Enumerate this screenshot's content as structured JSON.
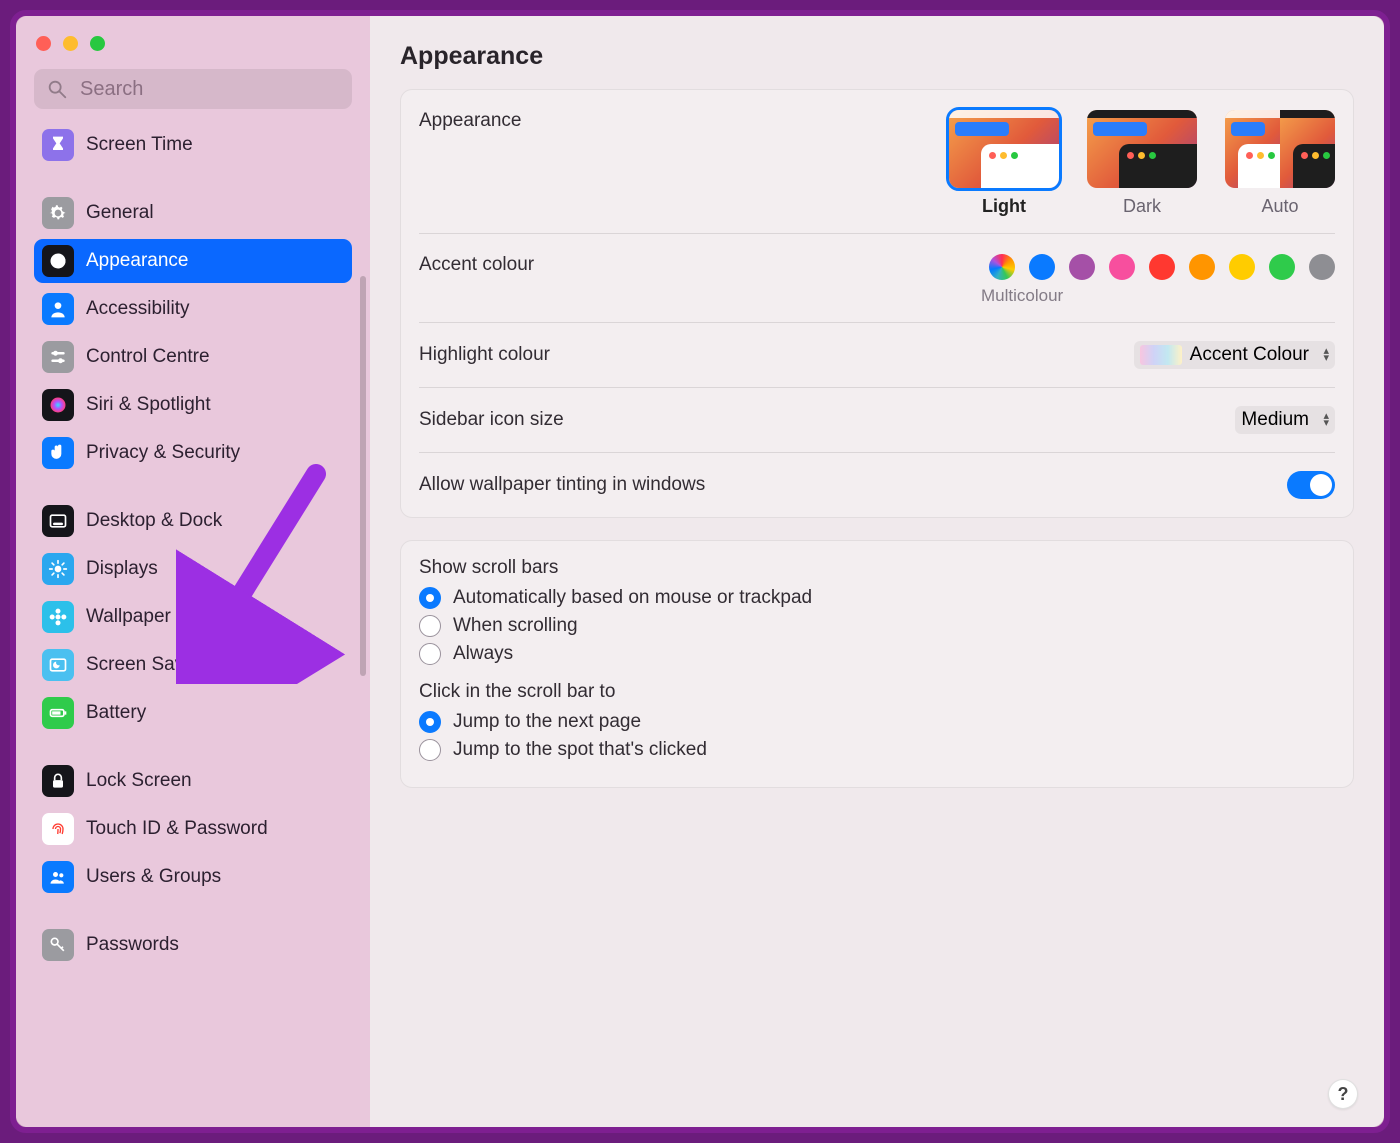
{
  "search": {
    "placeholder": "Search"
  },
  "page_title": "Appearance",
  "sidebar": {
    "items": [
      {
        "label": "Screen Time",
        "icon": "hourglass",
        "bg": "#8d72ea",
        "fg": "#ffffff"
      },
      {
        "gap": true
      },
      {
        "label": "General",
        "icon": "gear",
        "bg": "#9b9ba0",
        "fg": "#ffffff"
      },
      {
        "label": "Appearance",
        "icon": "contrast",
        "bg": "#15151a",
        "fg": "#ffffff",
        "selected": true
      },
      {
        "label": "Accessibility",
        "icon": "person",
        "bg": "#0a7aff",
        "fg": "#ffffff"
      },
      {
        "label": "Control Centre",
        "icon": "sliders",
        "bg": "#9b9ba0",
        "fg": "#ffffff"
      },
      {
        "label": "Siri & Spotlight",
        "icon": "siri",
        "bg": "#15151a",
        "fg": "#ffffff"
      },
      {
        "label": "Privacy & Security",
        "icon": "hand",
        "bg": "#0a7aff",
        "fg": "#ffffff"
      },
      {
        "gap": true
      },
      {
        "label": "Desktop & Dock",
        "icon": "dock",
        "bg": "#15151a",
        "fg": "#ffffff"
      },
      {
        "label": "Displays",
        "icon": "sun",
        "bg": "#2aa7ef",
        "fg": "#ffffff"
      },
      {
        "label": "Wallpaper",
        "icon": "flower",
        "bg": "#2cc0ea",
        "fg": "#ffffff"
      },
      {
        "label": "Screen Saver",
        "icon": "moon",
        "bg": "#4ac0f0",
        "fg": "#ffffff"
      },
      {
        "label": "Battery",
        "icon": "battery",
        "bg": "#2fcb4b",
        "fg": "#ffffff"
      },
      {
        "gap": true
      },
      {
        "label": "Lock Screen",
        "icon": "lock",
        "bg": "#15151a",
        "fg": "#ffffff"
      },
      {
        "label": "Touch ID & Password",
        "icon": "fingerprint",
        "bg": "#ffffff",
        "fg": "#ff3b30"
      },
      {
        "label": "Users & Groups",
        "icon": "users",
        "bg": "#0a7aff",
        "fg": "#ffffff"
      },
      {
        "gap": true
      },
      {
        "label": "Passwords",
        "icon": "key",
        "bg": "#9b9ba0",
        "fg": "#ffffff"
      }
    ]
  },
  "appearance": {
    "section_label": "Appearance",
    "modes": [
      {
        "label": "Light",
        "selected": true
      },
      {
        "label": "Dark",
        "selected": false
      },
      {
        "label": "Auto",
        "selected": false
      }
    ],
    "accent": {
      "label": "Accent colour",
      "caption": "Multicolour",
      "colors": [
        "multi",
        "#0a7aff",
        "#a550a7",
        "#f74f9e",
        "#ff3830",
        "#ff9500",
        "#ffcc00",
        "#2fcb4b",
        "#8e8e93"
      ]
    },
    "highlight": {
      "label": "Highlight colour",
      "value": "Accent Colour"
    },
    "sidebar_size": {
      "label": "Sidebar icon size",
      "value": "Medium"
    },
    "tinting": {
      "label": "Allow wallpaper tinting in windows",
      "value": true
    }
  },
  "scroll": {
    "show_label": "Show scroll bars",
    "show_opts": [
      "Automatically based on mouse or trackpad",
      "When scrolling",
      "Always"
    ],
    "show_selected": 0,
    "click_label": "Click in the scroll bar to",
    "click_opts": [
      "Jump to the next page",
      "Jump to the spot that's clicked"
    ],
    "click_selected": 0
  },
  "help": "?"
}
